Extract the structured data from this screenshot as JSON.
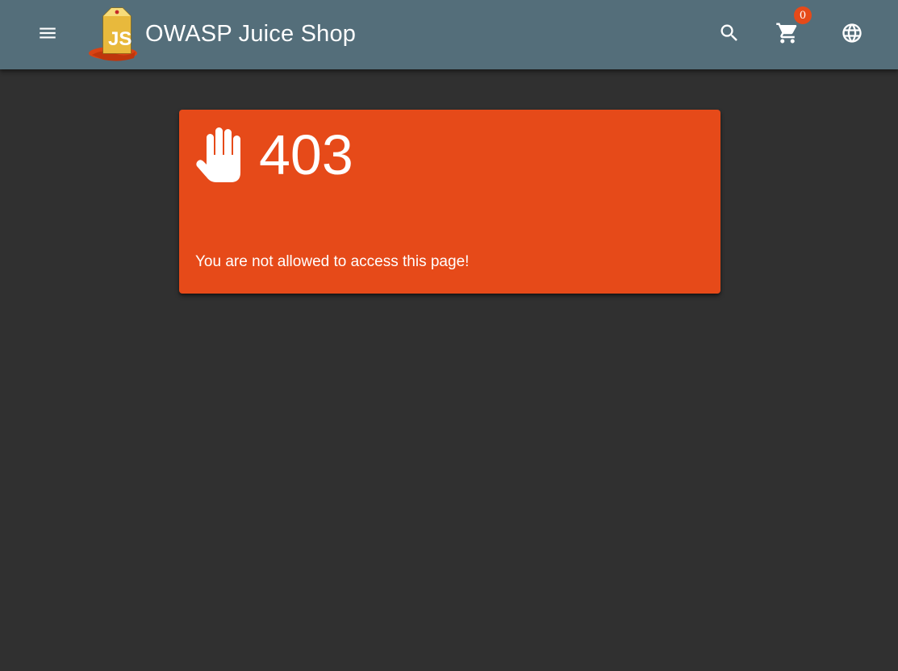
{
  "toolbar": {
    "title": "OWASP Juice Shop",
    "menu_icon": "menu-icon",
    "logo": "juice-box-logo",
    "search_icon": "search-icon",
    "cart_icon": "shopping-cart-icon",
    "cart_count": "0",
    "language_icon": "globe-icon"
  },
  "error": {
    "icon": "hand-stop-icon",
    "code": "403",
    "message": "You are not allowed to access this page!"
  },
  "colors": {
    "toolbar_bg": "#546e7a",
    "page_bg": "#303030",
    "card_bg": "#e64a19",
    "badge_bg": "#e64a19",
    "text": "#ffffff"
  }
}
